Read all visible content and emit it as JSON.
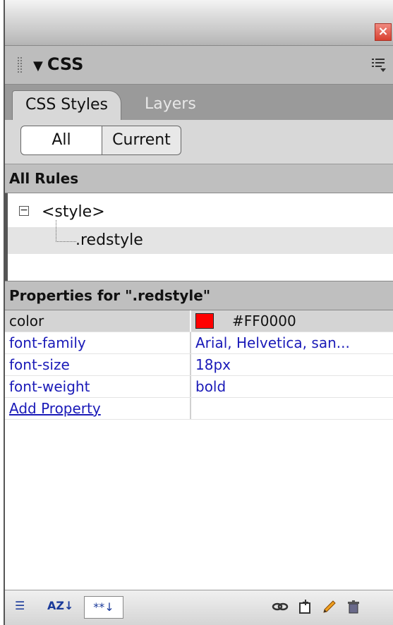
{
  "window": {
    "close_label": "×"
  },
  "panel": {
    "title": "CSS",
    "collapse_glyph": "▼"
  },
  "tabs": [
    {
      "label": "CSS Styles",
      "active": true
    },
    {
      "label": "Layers",
      "active": false
    }
  ],
  "mode": {
    "all_label": "All",
    "current_label": "Current",
    "selected": "All"
  },
  "rules": {
    "header": "All Rules",
    "items": [
      {
        "label": "<style>",
        "expander": "−"
      },
      {
        "label": ".redstyle",
        "selected": true
      }
    ]
  },
  "properties": {
    "header": "Properties for \".redstyle\"",
    "rows": [
      {
        "name": "color",
        "value": "#FF0000",
        "swatch": "#FF0000"
      },
      {
        "name": "font-family",
        "value": "Arial, Helvetica, san..."
      },
      {
        "name": "font-size",
        "value": "18px"
      },
      {
        "name": "font-weight",
        "value": "bold"
      },
      {
        "name": "Add Property",
        "value": ""
      }
    ]
  },
  "toolbar": {
    "left": [
      {
        "icon": "category-view-icon",
        "label": "☰"
      },
      {
        "icon": "alpha-view-icon",
        "label": "AZ↓"
      },
      {
        "icon": "set-properties-icon",
        "label": "**↓"
      }
    ],
    "right": [
      "attach-style-sheet-icon",
      "new-css-rule-icon",
      "edit-style-icon",
      "delete-icon"
    ]
  }
}
